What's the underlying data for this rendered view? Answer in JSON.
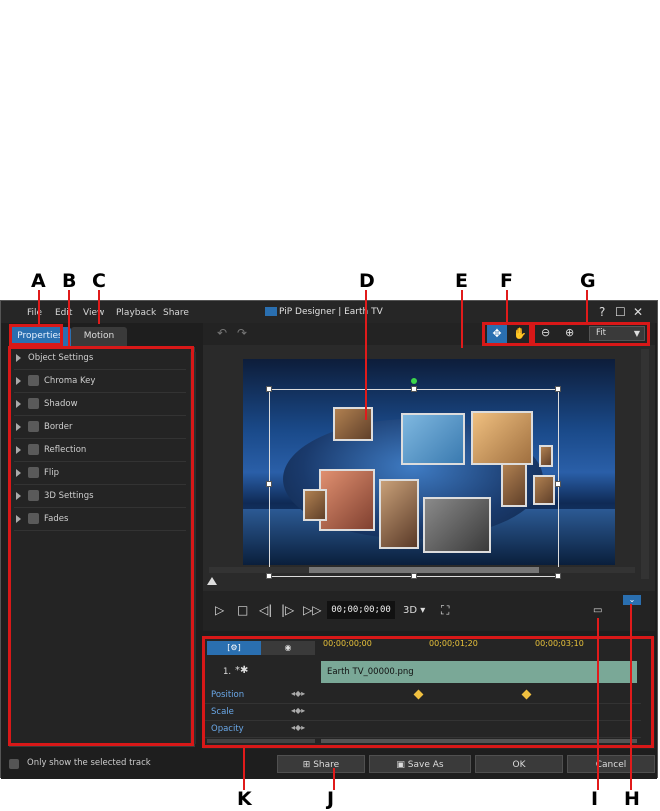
{
  "callouts": {
    "A": "A",
    "B": "B",
    "C": "C",
    "D": "D",
    "E": "E",
    "F": "F",
    "G": "G",
    "H": "H",
    "I": "I",
    "J": "J",
    "K": "K"
  },
  "menu": {
    "file": "File",
    "edit": "Edit",
    "view": "View",
    "playback": "Playback",
    "share": "Share"
  },
  "window_title": "PiP Designer | Earth TV",
  "window_buttons": {
    "help": "?",
    "maximize": "☐",
    "close": "✕"
  },
  "tabs": {
    "properties": "Properties",
    "motion": "Motion"
  },
  "properties": [
    {
      "label": "Object Settings",
      "checkbox": false
    },
    {
      "label": "Chroma Key",
      "checkbox": true
    },
    {
      "label": "Shadow",
      "checkbox": true
    },
    {
      "label": "Border",
      "checkbox": true
    },
    {
      "label": "Reflection",
      "checkbox": true
    },
    {
      "label": "Flip",
      "checkbox": true
    },
    {
      "label": "3D Settings",
      "checkbox": true
    },
    {
      "label": "Fades",
      "checkbox": true
    }
  ],
  "zoom": {
    "value": "Fit"
  },
  "player": {
    "timecode": "00;00;00;00",
    "mode_3d": "3D"
  },
  "timeline": {
    "ruler": [
      "00;00;00;00",
      "00;00;01;20",
      "00;00;03;10"
    ],
    "track_label": "1.",
    "clip_name": "Earth TV_00000.png",
    "rows": [
      "Position",
      "Scale",
      "Opacity"
    ]
  },
  "bottom": {
    "only_selected": "Only show the selected track",
    "share": "Share",
    "save_as": "Save As",
    "ok": "OK",
    "cancel": "Cancel"
  },
  "colors": {
    "callout_red": "#d81818",
    "accent_blue": "#2a6fb0",
    "clip_green": "#7aa897"
  }
}
